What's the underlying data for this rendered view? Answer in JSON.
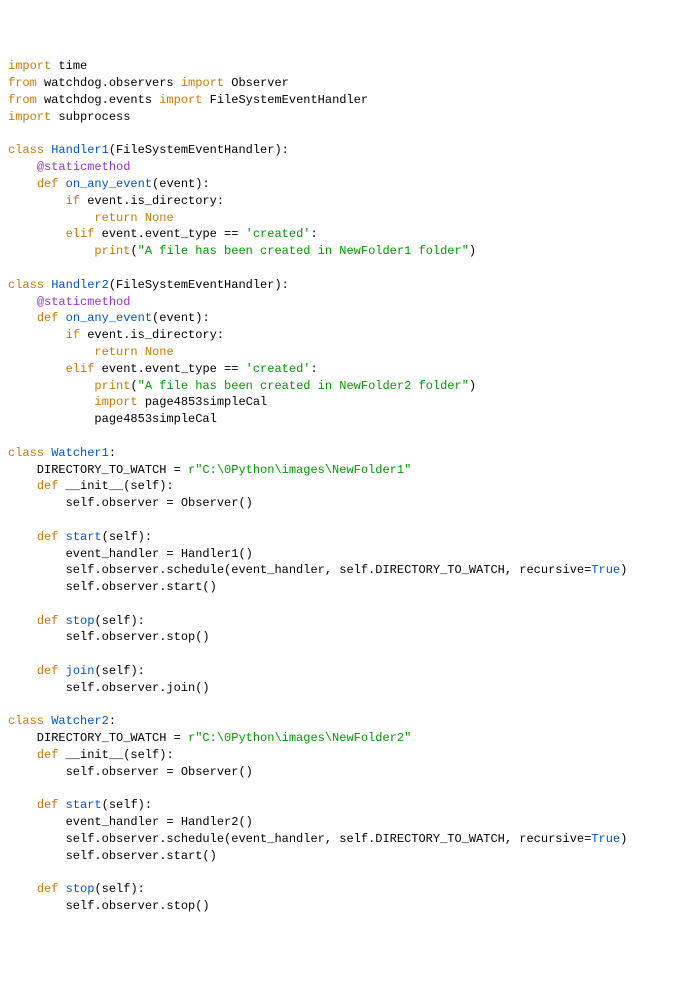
{
  "code": {
    "lines": [
      [
        {
          "t": "import",
          "c": "kw"
        },
        {
          "t": " time",
          "c": "id"
        }
      ],
      [
        {
          "t": "from",
          "c": "kw"
        },
        {
          "t": " watchdog.observers ",
          "c": "id"
        },
        {
          "t": "import",
          "c": "kw"
        },
        {
          "t": " Observer",
          "c": "id"
        }
      ],
      [
        {
          "t": "from",
          "c": "kw"
        },
        {
          "t": " watchdog.events ",
          "c": "id"
        },
        {
          "t": "import",
          "c": "kw"
        },
        {
          "t": " FileSystemEventHandler",
          "c": "id"
        }
      ],
      [
        {
          "t": "import",
          "c": "kw"
        },
        {
          "t": " subprocess",
          "c": "id"
        }
      ],
      [
        {
          "t": "",
          "c": "id"
        }
      ],
      [
        {
          "t": "class",
          "c": "kw"
        },
        {
          "t": " ",
          "c": "id"
        },
        {
          "t": "Handler1",
          "c": "cls"
        },
        {
          "t": "(FileSystemEventHandler):",
          "c": "id"
        }
      ],
      [
        {
          "t": "    ",
          "c": "id"
        },
        {
          "t": "@staticmethod",
          "c": "dec"
        }
      ],
      [
        {
          "t": "    ",
          "c": "id"
        },
        {
          "t": "def",
          "c": "kw"
        },
        {
          "t": " ",
          "c": "id"
        },
        {
          "t": "on_any_event",
          "c": "fn"
        },
        {
          "t": "(event):",
          "c": "id"
        }
      ],
      [
        {
          "t": "        ",
          "c": "id"
        },
        {
          "t": "if",
          "c": "kw"
        },
        {
          "t": " event.is_directory:",
          "c": "id"
        }
      ],
      [
        {
          "t": "            ",
          "c": "id"
        },
        {
          "t": "return",
          "c": "kw"
        },
        {
          "t": " ",
          "c": "id"
        },
        {
          "t": "None",
          "c": "kw"
        }
      ],
      [
        {
          "t": "        ",
          "c": "id"
        },
        {
          "t": "elif",
          "c": "kw"
        },
        {
          "t": " event.event_type == ",
          "c": "id"
        },
        {
          "t": "'created'",
          "c": "str"
        },
        {
          "t": ":",
          "c": "id"
        }
      ],
      [
        {
          "t": "            ",
          "c": "id"
        },
        {
          "t": "print",
          "c": "kw"
        },
        {
          "t": "(",
          "c": "id"
        },
        {
          "t": "\"A file has been created in NewFolder1 folder\"",
          "c": "str"
        },
        {
          "t": ")",
          "c": "id"
        }
      ],
      [
        {
          "t": "",
          "c": "id"
        }
      ],
      [
        {
          "t": "class",
          "c": "kw"
        },
        {
          "t": " ",
          "c": "id"
        },
        {
          "t": "Handler2",
          "c": "cls"
        },
        {
          "t": "(FileSystemEventHandler):",
          "c": "id"
        }
      ],
      [
        {
          "t": "    ",
          "c": "id"
        },
        {
          "t": "@staticmethod",
          "c": "dec"
        }
      ],
      [
        {
          "t": "    ",
          "c": "id"
        },
        {
          "t": "def",
          "c": "kw"
        },
        {
          "t": " ",
          "c": "id"
        },
        {
          "t": "on_any_event",
          "c": "fn"
        },
        {
          "t": "(event):",
          "c": "id"
        }
      ],
      [
        {
          "t": "        ",
          "c": "id"
        },
        {
          "t": "if",
          "c": "kw"
        },
        {
          "t": " event.is_directory:",
          "c": "id"
        }
      ],
      [
        {
          "t": "            ",
          "c": "id"
        },
        {
          "t": "return",
          "c": "kw"
        },
        {
          "t": " ",
          "c": "id"
        },
        {
          "t": "None",
          "c": "kw"
        }
      ],
      [
        {
          "t": "        ",
          "c": "id"
        },
        {
          "t": "elif",
          "c": "kw"
        },
        {
          "t": " event.event_type == ",
          "c": "id"
        },
        {
          "t": "'created'",
          "c": "str"
        },
        {
          "t": ":",
          "c": "id"
        }
      ],
      [
        {
          "t": "            ",
          "c": "id"
        },
        {
          "t": "print",
          "c": "kw"
        },
        {
          "t": "(",
          "c": "id"
        },
        {
          "t": "\"A file has been created in NewFolder2 folder\"",
          "c": "str"
        },
        {
          "t": ")",
          "c": "id"
        }
      ],
      [
        {
          "t": "            ",
          "c": "id"
        },
        {
          "t": "import",
          "c": "kw"
        },
        {
          "t": " page4853simpleCal",
          "c": "id"
        }
      ],
      [
        {
          "t": "            page4853simpleCal",
          "c": "id"
        }
      ],
      [
        {
          "t": "",
          "c": "id"
        }
      ],
      [
        {
          "t": "class",
          "c": "kw"
        },
        {
          "t": " ",
          "c": "id"
        },
        {
          "t": "Watcher1",
          "c": "cls"
        },
        {
          "t": ":",
          "c": "id"
        }
      ],
      [
        {
          "t": "    DIRECTORY_TO_WATCH = ",
          "c": "id"
        },
        {
          "t": "r\"C:\\0Python\\images\\NewFolder1\"",
          "c": "str"
        }
      ],
      [
        {
          "t": "    ",
          "c": "id"
        },
        {
          "t": "def",
          "c": "kw"
        },
        {
          "t": " __init__(self):",
          "c": "id"
        }
      ],
      [
        {
          "t": "        self.observer = Observer()",
          "c": "id"
        }
      ],
      [
        {
          "t": "",
          "c": "id"
        }
      ],
      [
        {
          "t": "    ",
          "c": "id"
        },
        {
          "t": "def",
          "c": "kw"
        },
        {
          "t": " ",
          "c": "id"
        },
        {
          "t": "start",
          "c": "fn"
        },
        {
          "t": "(self):",
          "c": "id"
        }
      ],
      [
        {
          "t": "        event_handler = Handler1()",
          "c": "id"
        }
      ],
      [
        {
          "t": "        self.observer.schedule(event_handler, self.DIRECTORY_TO_WATCH, recursive=",
          "c": "id"
        },
        {
          "t": "True",
          "c": "bool"
        },
        {
          "t": ")",
          "c": "id"
        }
      ],
      [
        {
          "t": "        self.observer.start()",
          "c": "id"
        }
      ],
      [
        {
          "t": "",
          "c": "id"
        }
      ],
      [
        {
          "t": "    ",
          "c": "id"
        },
        {
          "t": "def",
          "c": "kw"
        },
        {
          "t": " ",
          "c": "id"
        },
        {
          "t": "stop",
          "c": "fn"
        },
        {
          "t": "(self):",
          "c": "id"
        }
      ],
      [
        {
          "t": "        self.observer.stop()",
          "c": "id"
        }
      ],
      [
        {
          "t": "",
          "c": "id"
        }
      ],
      [
        {
          "t": "    ",
          "c": "id"
        },
        {
          "t": "def",
          "c": "kw"
        },
        {
          "t": " ",
          "c": "id"
        },
        {
          "t": "join",
          "c": "fn"
        },
        {
          "t": "(self):",
          "c": "id"
        }
      ],
      [
        {
          "t": "        self.observer.join()",
          "c": "id"
        }
      ],
      [
        {
          "t": "",
          "c": "id"
        }
      ],
      [
        {
          "t": "class",
          "c": "kw"
        },
        {
          "t": " ",
          "c": "id"
        },
        {
          "t": "Watcher2",
          "c": "cls"
        },
        {
          "t": ":",
          "c": "id"
        }
      ],
      [
        {
          "t": "    DIRECTORY_TO_WATCH = ",
          "c": "id"
        },
        {
          "t": "r\"C:\\0Python\\images\\NewFolder2\"",
          "c": "str"
        }
      ],
      [
        {
          "t": "    ",
          "c": "id"
        },
        {
          "t": "def",
          "c": "kw"
        },
        {
          "t": " __init__(self):",
          "c": "id"
        }
      ],
      [
        {
          "t": "        self.observer = Observer()",
          "c": "id"
        }
      ],
      [
        {
          "t": "",
          "c": "id"
        }
      ],
      [
        {
          "t": "    ",
          "c": "id"
        },
        {
          "t": "def",
          "c": "kw"
        },
        {
          "t": " ",
          "c": "id"
        },
        {
          "t": "start",
          "c": "fn"
        },
        {
          "t": "(self):",
          "c": "id"
        }
      ],
      [
        {
          "t": "        event_handler = Handler2()",
          "c": "id"
        }
      ],
      [
        {
          "t": "        self.observer.schedule(event_handler, self.DIRECTORY_TO_WATCH, recursive=",
          "c": "id"
        },
        {
          "t": "True",
          "c": "bool"
        },
        {
          "t": ")",
          "c": "id"
        }
      ],
      [
        {
          "t": "        self.observer.start()",
          "c": "id"
        }
      ],
      [
        {
          "t": "",
          "c": "id"
        }
      ],
      [
        {
          "t": "    ",
          "c": "id"
        },
        {
          "t": "def",
          "c": "kw"
        },
        {
          "t": " ",
          "c": "id"
        },
        {
          "t": "stop",
          "c": "fn"
        },
        {
          "t": "(self):",
          "c": "id"
        }
      ],
      [
        {
          "t": "        self.observer.stop()",
          "c": "id"
        }
      ]
    ]
  }
}
